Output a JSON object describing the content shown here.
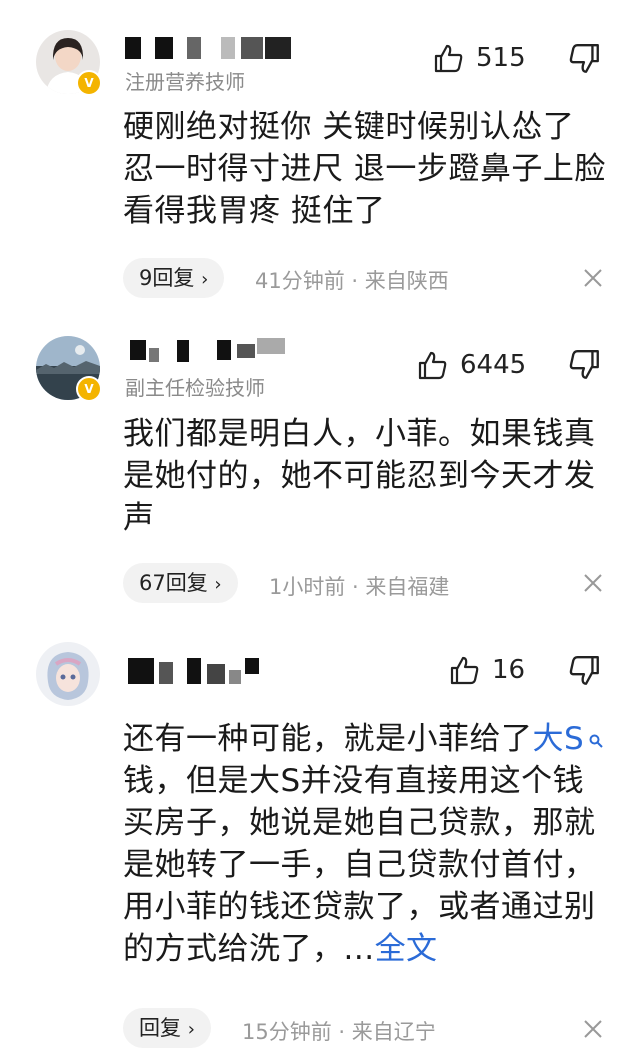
{
  "comments": [
    {
      "role": "注册营养技师",
      "likes": "515",
      "text": "硬刚绝对挺你 关键时候别认怂了 忍一时得寸进尺 退一步蹬鼻子上脸 看得我胃疼 挺住了",
      "reply_label": "9回复",
      "meta": "41分钟前 · 来自陕西"
    },
    {
      "role": "副主任检验技师",
      "likes": "6445",
      "text": "我们都是明白人，小菲。如果钱真是她付的，她不可能忍到今天才发声",
      "reply_label": "67回复",
      "meta": "1小时前 · 来自福建"
    },
    {
      "likes": "16",
      "text_before": "还有一种可能，就是小菲给了",
      "text_link": "大S",
      "text_after": "钱，但是大S并没有直接用这个钱买房子，她说是她自己贷款，那就是她转了一手，自己贷款付首付，用小菲的钱还贷款了，或者通过别的方式给洗了，...",
      "more_label": "全文",
      "reply_label": "回复",
      "meta": "15分钟前 · 来自辽宁"
    }
  ],
  "badge_letter": "V",
  "icons": {
    "like": "thumbs-up-icon",
    "dislike": "thumbs-down-icon",
    "close": "close-icon",
    "search": "search-icon",
    "chevron": "chevron-right-icon"
  }
}
